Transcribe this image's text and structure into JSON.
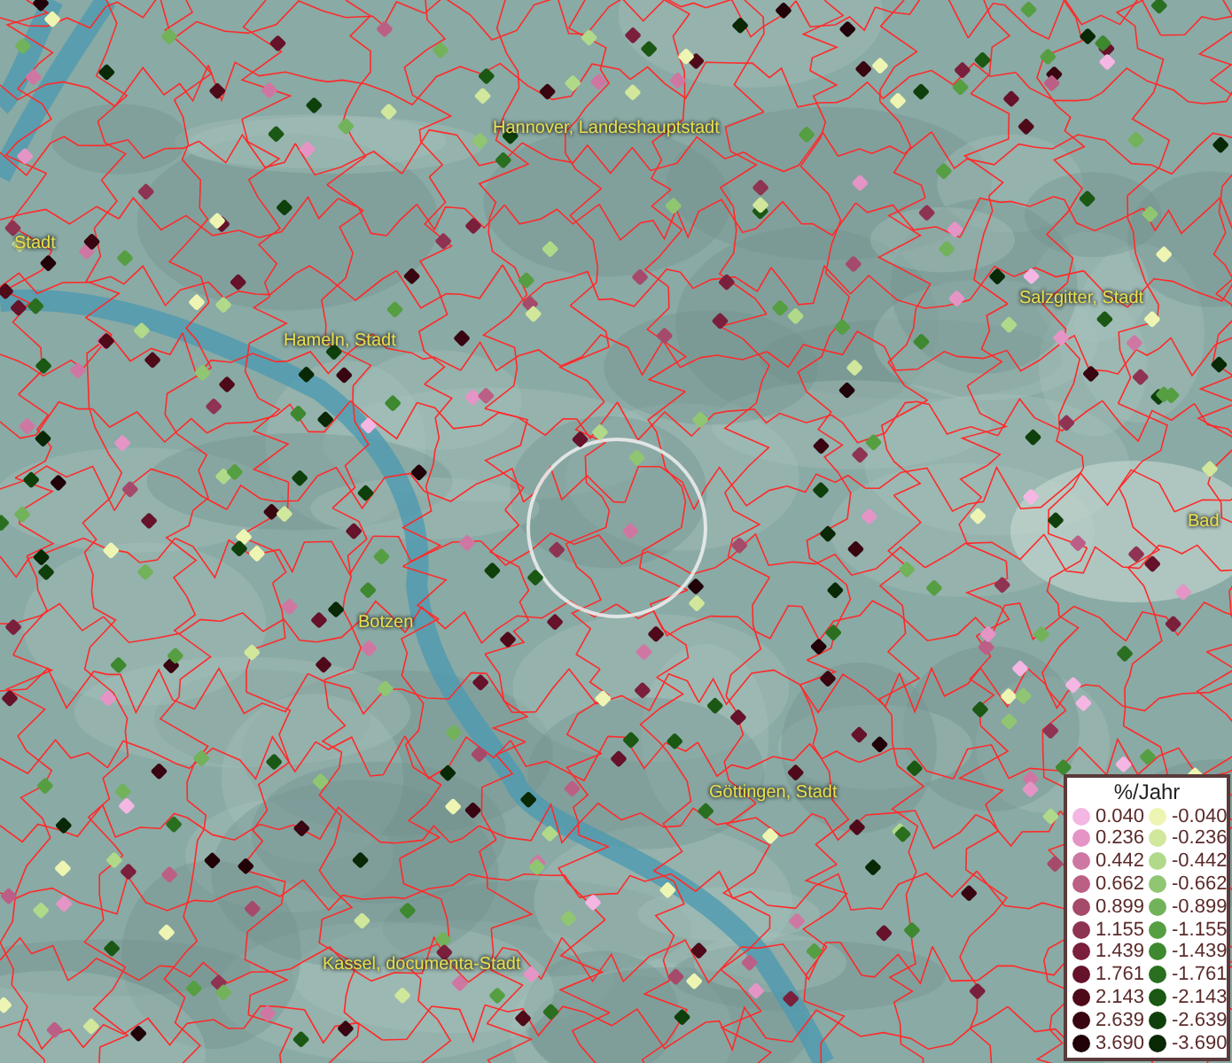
{
  "map": {
    "places": [
      "Stadt",
      "Hannover, Landeshauptstadt",
      "Hameln, Stadt",
      "Salzgitter, Stadt",
      "Bad",
      "Botzen",
      "Göttingen, Stadt",
      "Kassel, documenta-Stadt"
    ]
  },
  "legend": {
    "title": "%/Jahr",
    "positive": [
      {
        "label": "0.040",
        "color": "#f4b6e2"
      },
      {
        "label": "0.236",
        "color": "#e495c6"
      },
      {
        "label": "0.442",
        "color": "#cf77a3"
      },
      {
        "label": "0.662",
        "color": "#bb5f86"
      },
      {
        "label": "0.899",
        "color": "#a54a6a"
      },
      {
        "label": "1.155",
        "color": "#8f3352"
      },
      {
        "label": "1.439",
        "color": "#7a203c"
      },
      {
        "label": "1.761",
        "color": "#65122a"
      },
      {
        "label": "2.143",
        "color": "#4f0a1a"
      },
      {
        "label": "2.639",
        "color": "#380510"
      },
      {
        "label": "3.690",
        "color": "#200208"
      }
    ],
    "negative": [
      {
        "label": "-0.040",
        "color": "#eef5b2"
      },
      {
        "label": "-0.236",
        "color": "#d0e79c"
      },
      {
        "label": "-0.442",
        "color": "#b0d98a"
      },
      {
        "label": "-0.662",
        "color": "#90c672"
      },
      {
        "label": "-0.899",
        "color": "#72b25a"
      },
      {
        "label": "-1.155",
        "color": "#569e42"
      },
      {
        "label": "-1.439",
        "color": "#3e8830"
      },
      {
        "label": "-1.761",
        "color": "#2a6f20"
      },
      {
        "label": "-2.143",
        "color": "#1a5814"
      },
      {
        "label": "-2.639",
        "color": "#0f400b"
      },
      {
        "label": "-3.690",
        "color": "#082806"
      }
    ]
  }
}
